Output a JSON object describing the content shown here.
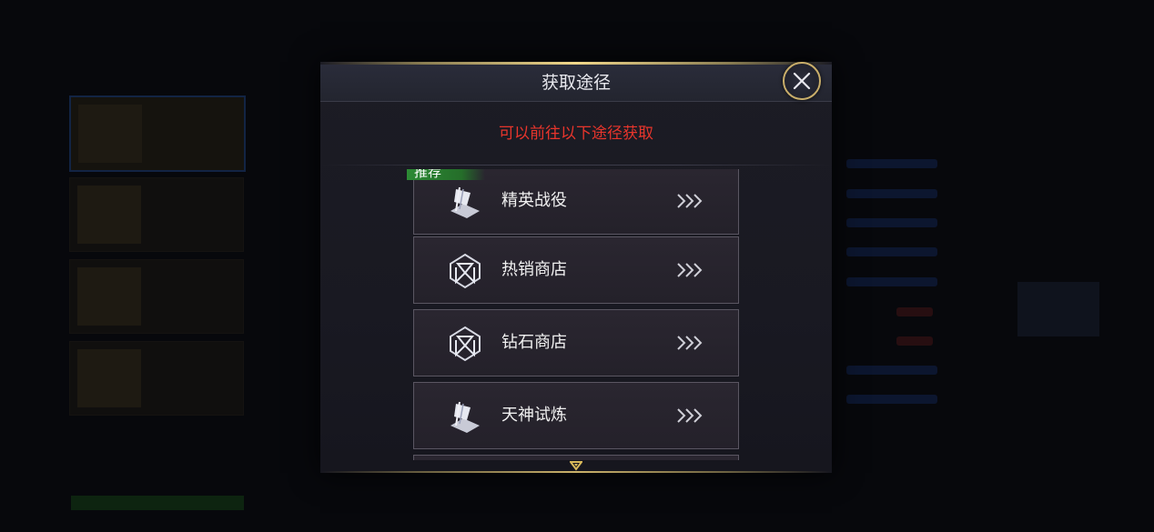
{
  "modal": {
    "title": "获取途径",
    "subtitle": "可以前往以下途径获取",
    "recommend_tag": "推荐",
    "routes": [
      {
        "label": "精英战役",
        "icon": "campaign-flag-icon"
      },
      {
        "label": "热销商店",
        "icon": "shop-emblem-icon"
      },
      {
        "label": "钻石商店",
        "icon": "diamond-shop-emblem-icon"
      },
      {
        "label": "天神试炼",
        "icon": "trial-flag-icon"
      }
    ]
  },
  "colors": {
    "accent_gold": "#c9ae6a",
    "subtitle_red": "#e8352c",
    "recommend_green": "#2c8a34"
  }
}
